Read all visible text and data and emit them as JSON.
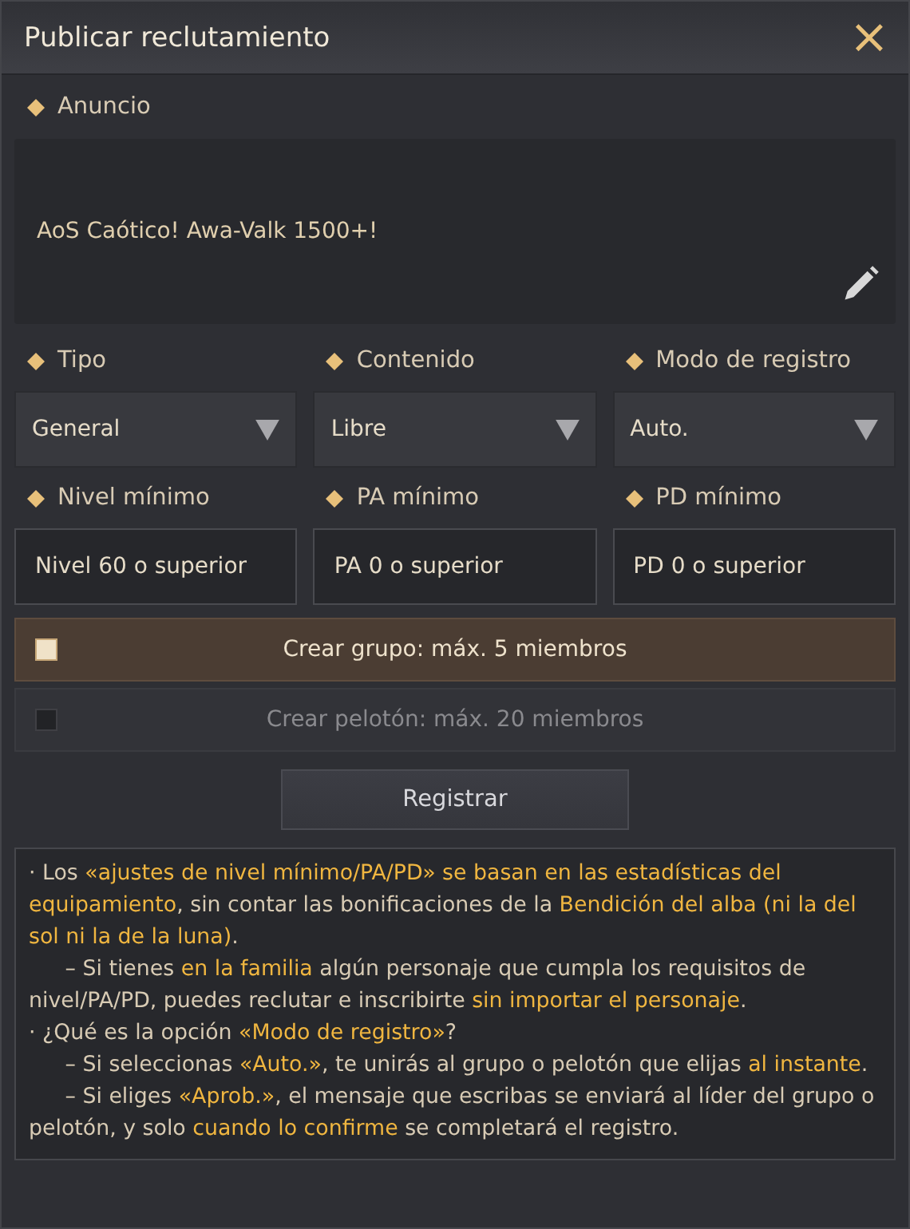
{
  "window": {
    "title": "Publicar reclutamiento",
    "close": "×"
  },
  "announcement": {
    "label": "Anuncio",
    "value": "AoS Caótico! Awa-Valk 1500+!"
  },
  "dropdowns": [
    {
      "label": "Tipo",
      "value": "General"
    },
    {
      "label": "Contenido",
      "value": "Libre"
    },
    {
      "label": "Modo de registro",
      "value": "Auto."
    }
  ],
  "minimums": [
    {
      "label": "Nivel mínimo",
      "value": "Nivel 60 o superior"
    },
    {
      "label": "PA mínimo",
      "value": "PA 0 o superior"
    },
    {
      "label": "PD mínimo",
      "value": "PD 0 o superior"
    }
  ],
  "options": [
    {
      "label": "Crear grupo: máx. 5 miembros",
      "checked": true
    },
    {
      "label": "Crear pelotón: máx. 20 miembros",
      "checked": false
    }
  ],
  "register_button": "Registrar",
  "notes": [
    {
      "kind": "bullet",
      "text": "· Los **«ajustes de nivel mínimo/PA/PD» se basan en las estadísticas del equipamiento**, sin contar las bonificaciones de la **Bendición del alba (ni la del sol ni la de la luna)**."
    },
    {
      "kind": "sub",
      "text": "– Si tienes **en la familia** algún personaje que cumpla los requisitos de nivel/PA/PD, puedes reclutar e inscribirte **sin importar el personaje**."
    },
    {
      "kind": "bullet",
      "text": "· ¿Qué es la opción **«Modo de registro»**?"
    },
    {
      "kind": "sub",
      "text": "– Si seleccionas **«Auto.»**, te unirás al grupo o pelotón que elijas **al instante**."
    },
    {
      "kind": "sub",
      "text": "– Si eliges **«Aprob.»**, el mensaje que escribas se enviará al líder del grupo o pelotón, y solo **cuando lo confirme** se completará el registro."
    }
  ]
}
